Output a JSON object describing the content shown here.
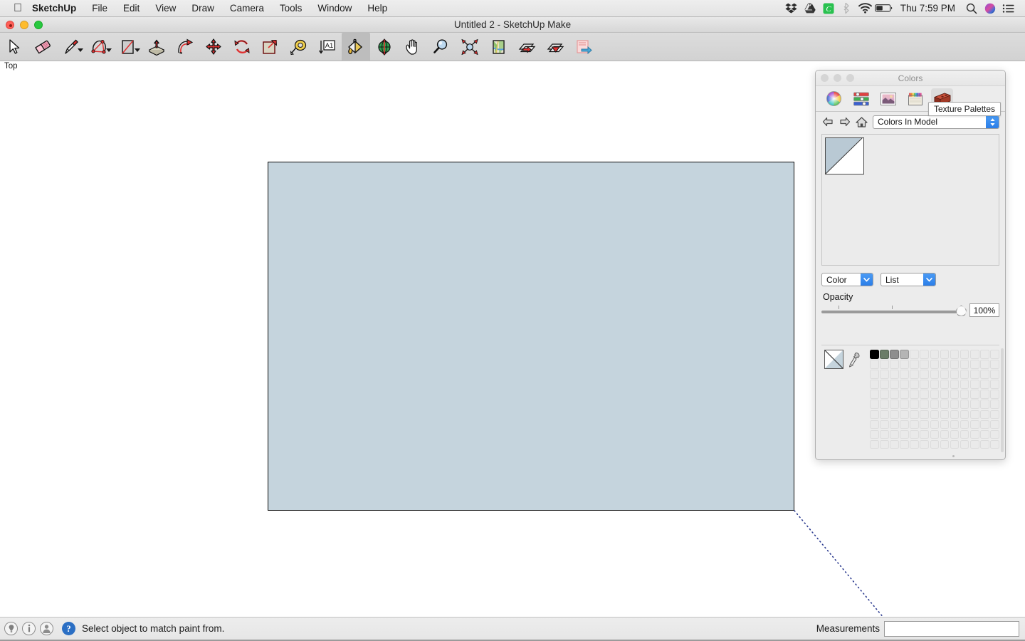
{
  "menubar": {
    "apple_icon": "apple-logo",
    "items": [
      {
        "label": "SketchUp",
        "bold": true
      },
      {
        "label": "File",
        "bold": false
      },
      {
        "label": "Edit",
        "bold": false
      },
      {
        "label": "View",
        "bold": false
      },
      {
        "label": "Draw",
        "bold": false
      },
      {
        "label": "Camera",
        "bold": false
      },
      {
        "label": "Tools",
        "bold": false
      },
      {
        "label": "Window",
        "bold": false
      },
      {
        "label": "Help",
        "bold": false
      }
    ],
    "status_icons": [
      {
        "name": "dropbox-icon"
      },
      {
        "name": "google-drive-icon"
      },
      {
        "name": "cloud-app-icon"
      },
      {
        "name": "bluetooth-icon"
      },
      {
        "name": "wifi-icon"
      },
      {
        "name": "battery-icon"
      }
    ],
    "clock": "Thu 7:59 PM",
    "right_icons": [
      {
        "name": "spotlight-search-icon"
      },
      {
        "name": "siri-icon"
      },
      {
        "name": "notification-center-icon"
      }
    ]
  },
  "window": {
    "title": "Untitled 2 - SketchUp Make",
    "traffic_lights": [
      "close",
      "minimize",
      "zoom"
    ]
  },
  "toolbar": {
    "tools": [
      {
        "name": "select-tool",
        "icon": "arrow-cursor-icon",
        "caret": false,
        "active": false
      },
      {
        "name": "eraser-tool",
        "icon": "eraser-icon",
        "caret": false,
        "active": false
      },
      {
        "name": "line-tool",
        "icon": "pencil-icon",
        "caret": true,
        "active": false
      },
      {
        "name": "arc-tool",
        "icon": "arc-icon",
        "caret": true,
        "active": false
      },
      {
        "name": "rectangle-tool",
        "icon": "rectangle-icon",
        "caret": true,
        "active": false
      },
      {
        "name": "pushpull-tool",
        "icon": "pushpull-icon",
        "caret": false,
        "active": false
      },
      {
        "name": "followme-tool",
        "icon": "followme-icon",
        "caret": false,
        "active": false
      },
      {
        "name": "move-tool",
        "icon": "move-arrows-icon",
        "caret": false,
        "active": false
      },
      {
        "name": "rotate-tool",
        "icon": "rotate-icon",
        "caret": false,
        "active": false
      },
      {
        "name": "scale-tool",
        "icon": "scale-icon",
        "caret": false,
        "active": false
      },
      {
        "name": "tape-measure-tool",
        "icon": "tape-measure-icon",
        "caret": false,
        "active": false
      },
      {
        "name": "text-tool",
        "icon": "text-a1-icon",
        "caret": false,
        "active": false
      },
      {
        "name": "paint-bucket-tool",
        "icon": "paint-bucket-icon",
        "caret": false,
        "active": true
      },
      {
        "name": "orbit-tool",
        "icon": "orbit-icon",
        "caret": false,
        "active": false
      },
      {
        "name": "pan-tool",
        "icon": "hand-icon",
        "caret": false,
        "active": false
      },
      {
        "name": "zoom-tool",
        "icon": "magnifier-icon",
        "caret": false,
        "active": false
      },
      {
        "name": "zoom-extents-tool",
        "icon": "zoom-extents-icon",
        "caret": false,
        "active": false
      },
      {
        "name": "add-location-tool",
        "icon": "map-icon",
        "caret": false,
        "active": false
      },
      {
        "name": "previous-scene-tool",
        "icon": "scene-back-icon",
        "caret": false,
        "active": false
      },
      {
        "name": "next-scene-tool",
        "icon": "scene-forward-icon",
        "caret": false,
        "active": false
      },
      {
        "name": "share-model-tool",
        "icon": "share-export-icon",
        "caret": false,
        "active": false
      }
    ]
  },
  "viewport": {
    "view_label": "Top",
    "shape": {
      "name": "rectangle-face",
      "fill_color": "#c5d4dd",
      "stroke_color": "#0b0b0b"
    },
    "leader_line": {
      "name": "measurement-leader-line",
      "color": "#2b3a8f",
      "style": "dotted"
    }
  },
  "colors_panel": {
    "title": "Colors",
    "tabs": [
      {
        "name": "color-wheel-tab",
        "icon": "color-wheel-icon",
        "active": false
      },
      {
        "name": "color-sliders-tab",
        "icon": "sliders-icon",
        "active": false
      },
      {
        "name": "image-palettes-tab",
        "icon": "image-palette-icon",
        "active": false
      },
      {
        "name": "crayons-tab",
        "icon": "crayons-icon",
        "active": false
      },
      {
        "name": "texture-palettes-tab",
        "icon": "brick-icon",
        "active": true
      }
    ],
    "tooltip": "Texture Palettes",
    "nav": {
      "back_icon": "back-arrow-icon",
      "forward_icon": "forward-arrow-icon",
      "home_icon": "home-icon",
      "collection_value": "Colors In Model"
    },
    "model_swatch": {
      "name": "colors-in-model-swatch",
      "top_color": "#b9c9d4",
      "bottom_color": "#ffffff"
    },
    "view_select": "Color",
    "list_select": "List",
    "opacity_label": "Opacity",
    "opacity_value": "100%",
    "opacity_percent": 100,
    "picker_icon": "eyedropper-icon",
    "drag_swatch": {
      "name": "drag-color-swatch",
      "top_color": "#ffffff",
      "bottom_color": "#c5d4dd"
    },
    "swatch_grid": {
      "columns": 13,
      "rows": 10,
      "filled": [
        "#000000",
        "#6b7d68",
        "#8e8e8e",
        "#b5b5b5"
      ]
    }
  },
  "statusbar": {
    "icons": [
      {
        "name": "geo-location-icon"
      },
      {
        "name": "info-icon"
      },
      {
        "name": "credits-icon"
      }
    ],
    "help_icon": "help-question-icon",
    "message": "Select object to match paint from.",
    "measurements_label": "Measurements",
    "measurements_value": "",
    "measurements_placeholder": ""
  }
}
